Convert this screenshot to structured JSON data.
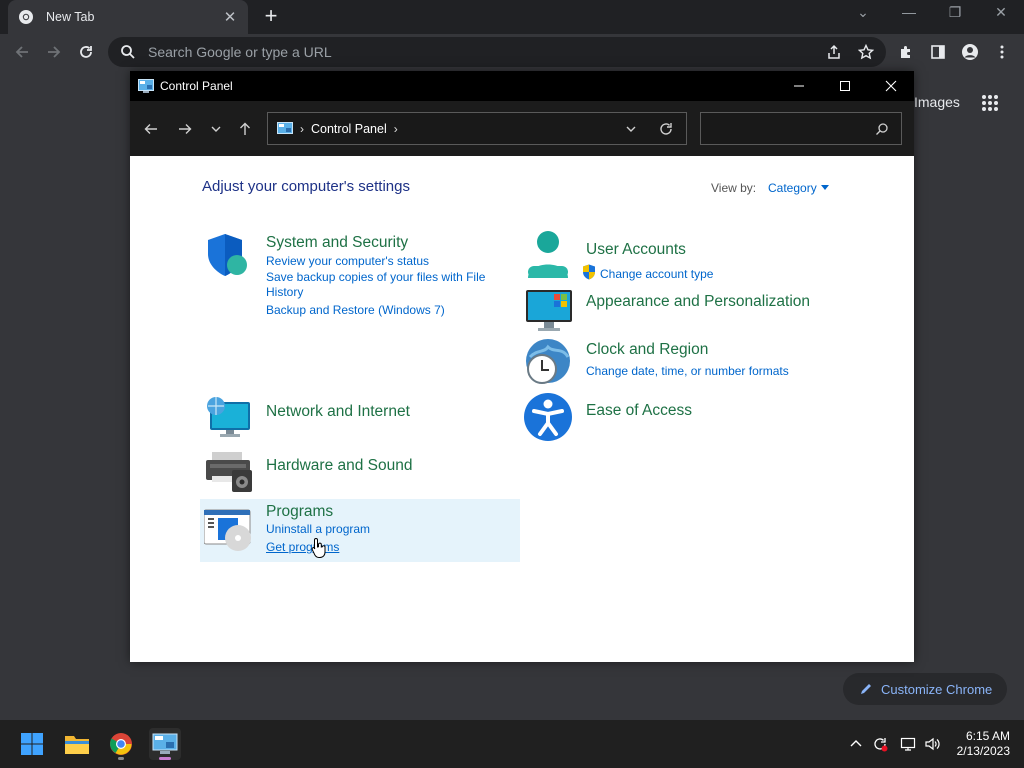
{
  "chrome": {
    "tab_title": "New Tab",
    "omnibox_placeholder": "Search Google or type a URL",
    "images_link": "Images",
    "customize_label": "Customize Chrome"
  },
  "control_panel": {
    "window_title": "Control Panel",
    "address_text": "Control Panel",
    "search_value": "",
    "heading": "Adjust your computer's settings",
    "view_by_label": "View by:",
    "view_by_value": "Category",
    "categories": [
      {
        "title": "System and Security",
        "links": [
          "Review your computer's status",
          "Save backup copies of your files with File History",
          "Backup and Restore (Windows 7)"
        ]
      },
      {
        "title": "Network and Internet",
        "links": []
      },
      {
        "title": "Hardware and Sound",
        "links": []
      },
      {
        "title": "Programs",
        "links": [
          "Uninstall a program",
          "Get programs"
        ]
      },
      {
        "title": "User Accounts",
        "links": [
          "Change account type"
        ]
      },
      {
        "title": "Appearance and Personalization",
        "links": []
      },
      {
        "title": "Clock and Region",
        "links": [
          "Change date, time, or number formats"
        ]
      },
      {
        "title": "Ease of Access",
        "links": []
      }
    ],
    "highlighted_category": "Programs"
  },
  "taskbar": {
    "apps": [
      "start-icon",
      "file-explorer-icon",
      "chrome-icon",
      "control-panel-icon"
    ],
    "time": "6:15 AM",
    "date": "2/13/2023"
  },
  "colors": {
    "category_title": "#1e7145",
    "link": "#0066cc",
    "heading": "#1e3287",
    "highlight": "#e5f3fb"
  }
}
